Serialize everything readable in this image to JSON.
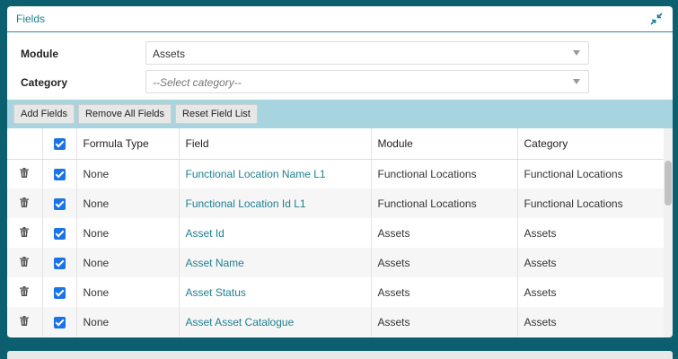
{
  "panel": {
    "title": "Fields"
  },
  "form": {
    "module_label": "Module",
    "module_value": "Assets",
    "category_label": "Category",
    "category_placeholder": "--Select category--"
  },
  "toolbar": {
    "add_fields": "Add Fields",
    "remove_all_fields": "Remove All Fields",
    "reset_field_list": "Reset Field List"
  },
  "table": {
    "headers": {
      "formula_type": "Formula Type",
      "field": "Field",
      "module": "Module",
      "category": "Category"
    },
    "rows": [
      {
        "checked": true,
        "formula_type": "None",
        "field": "Functional Location Name L1",
        "module": "Functional Locations",
        "category": "Functional Locations"
      },
      {
        "checked": true,
        "formula_type": "None",
        "field": "Functional Location Id L1",
        "module": "Functional Locations",
        "category": "Functional Locations"
      },
      {
        "checked": true,
        "formula_type": "None",
        "field": "Asset Id",
        "module": "Assets",
        "category": "Assets"
      },
      {
        "checked": true,
        "formula_type": "None",
        "field": "Asset Name",
        "module": "Assets",
        "category": "Assets"
      },
      {
        "checked": true,
        "formula_type": "None",
        "field": "Asset Status",
        "module": "Assets",
        "category": "Assets"
      },
      {
        "checked": true,
        "formula_type": "None",
        "field": "Asset Asset Catalogue",
        "module": "Assets",
        "category": "Assets"
      }
    ]
  },
  "icons": {
    "collapse": "collapse-arrows-icon",
    "delete": "trash-icon",
    "dropdown": "chevron-down-icon"
  },
  "colors": {
    "background": "#0c5f6e",
    "accent": "#1e7f91",
    "toolbar": "#a8d4e0",
    "checkbox": "#1a73e8"
  }
}
